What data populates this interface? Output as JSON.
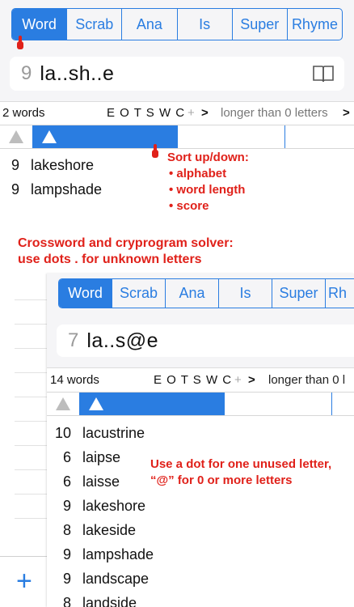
{
  "top": {
    "tabs": [
      {
        "label": "Word",
        "active": true
      },
      {
        "label": "Scrab",
        "active": false
      },
      {
        "label": "Ana",
        "active": false
      },
      {
        "label": "Is",
        "active": false
      },
      {
        "label": "Super",
        "active": false
      },
      {
        "label": "Rhyme",
        "active": false
      }
    ],
    "search": {
      "count": "9",
      "query": "la..sh..e",
      "icon": "book-icon"
    },
    "summary": {
      "count_text": "2 words",
      "letters": "E O T S W C",
      "plus": "+",
      "chevron": ">",
      "length_filter": "longer than 0 letters",
      "length_chevron": ">"
    },
    "results": [
      {
        "len": "9",
        "word": "lakeshore"
      },
      {
        "len": "9",
        "word": "lampshade"
      }
    ]
  },
  "notes": {
    "sort_title": "Sort up/down:",
    "sort_items": [
      "• alphabet",
      "• word length",
      "• score"
    ],
    "crossword_line1": "Crossword and cryprogram solver:",
    "crossword_line2": "use dots . for unknown letters",
    "dot_line1": "Use a dot for one unused letter,",
    "dot_line2": "“@” for 0 or more letters"
  },
  "inner": {
    "tabs": [
      {
        "label": "Word",
        "active": true
      },
      {
        "label": "Scrab",
        "active": false
      },
      {
        "label": "Ana",
        "active": false
      },
      {
        "label": "Is",
        "active": false
      },
      {
        "label": "Super",
        "active": false
      },
      {
        "label": "Rh",
        "active": false
      }
    ],
    "search": {
      "count": "7",
      "query": "la..s@e"
    },
    "summary": {
      "count_text": "14 words",
      "letters": "E O T S W C",
      "plus": "+",
      "chevron": ">",
      "length_filter": "longer than 0 l"
    },
    "results": [
      {
        "len": "10",
        "word": "lacustrine"
      },
      {
        "len": "6",
        "word": "laipse"
      },
      {
        "len": "6",
        "word": "laisse"
      },
      {
        "len": "9",
        "word": "lakeshore"
      },
      {
        "len": "8",
        "word": "lakeside"
      },
      {
        "len": "9",
        "word": "lampshade"
      },
      {
        "len": "9",
        "word": "landscape"
      },
      {
        "len": "8",
        "word": "landside"
      }
    ]
  },
  "sidebar": {
    "add_label": "+"
  },
  "colors": {
    "accent": "#2a7de1",
    "note": "#e0211a",
    "finger": "#e0211a"
  }
}
